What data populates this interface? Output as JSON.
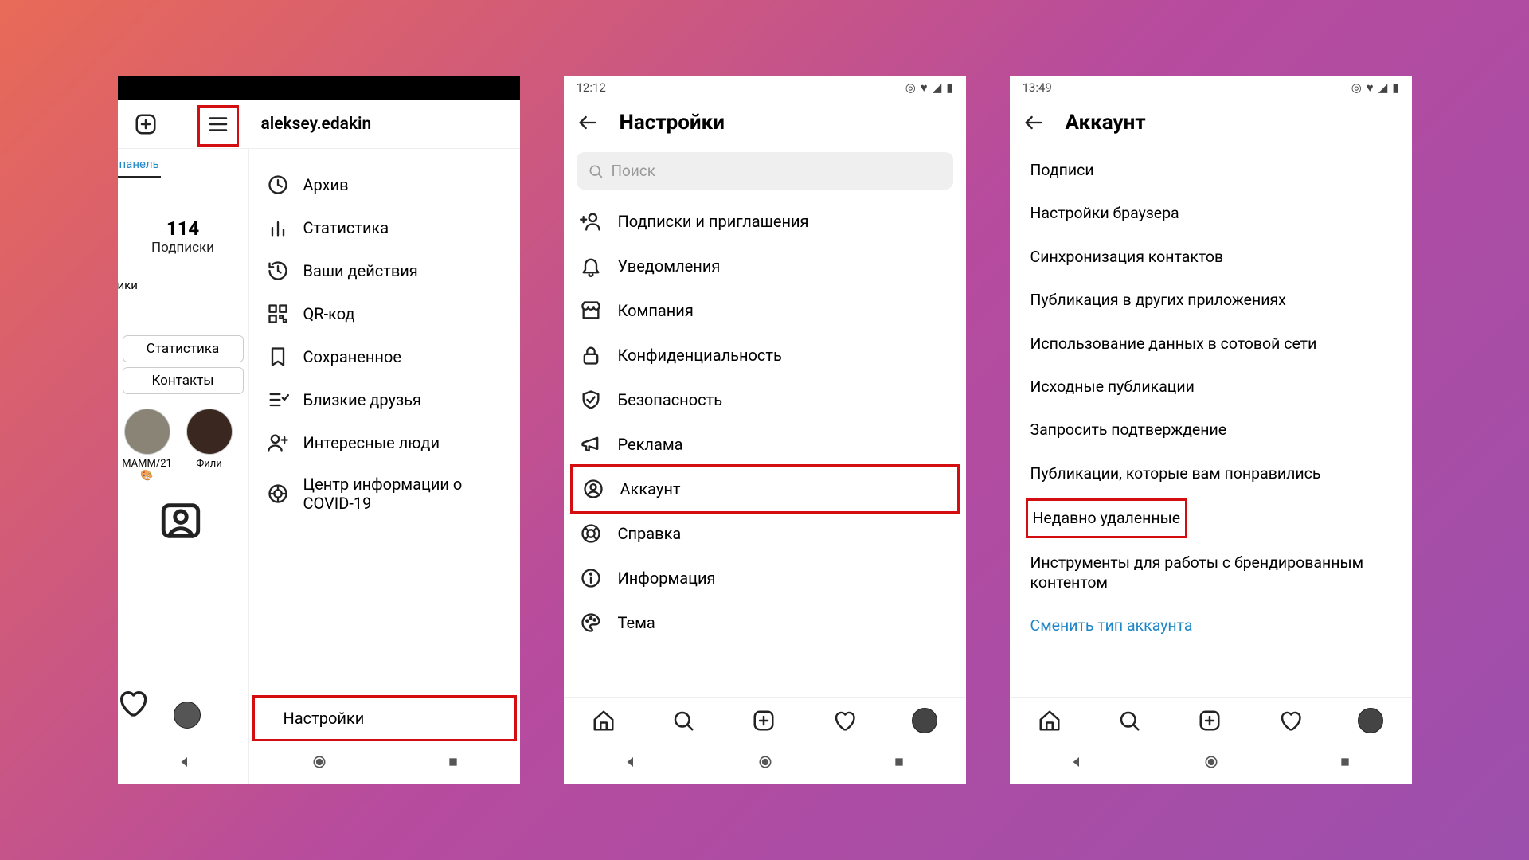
{
  "phone1": {
    "username": "aleksey.edakin",
    "panel_label": "панель",
    "stat_clip": "ики",
    "stats": {
      "num": "114",
      "label": "Подписки"
    },
    "chips": {
      "stats": "Статистика",
      "contacts": "Контакты"
    },
    "story1": "МАММ/21 🎨",
    "story2": "Фили",
    "menu": {
      "archive": "Архив",
      "insights": "Статистика",
      "activity": "Ваши действия",
      "qr": "QR-код",
      "saved": "Сохраненное",
      "close_friends": "Близкие друзья",
      "discover": "Интересные люди",
      "covid": "Центр информации о COVID-19",
      "settings": "Настройки"
    }
  },
  "phone2": {
    "time": "12:12",
    "title": "Настройки",
    "search_placeholder": "Поиск",
    "items": {
      "follow": "Подписки и приглашения",
      "notifications": "Уведомления",
      "company": "Компания",
      "privacy": "Конфиденциальность",
      "security": "Безопасность",
      "ads": "Реклама",
      "account": "Аккаунт",
      "help": "Справка",
      "about": "Информация",
      "theme": "Тема"
    }
  },
  "phone3": {
    "time": "13:49",
    "title": "Аккаунт",
    "items": {
      "captions": "Подписи",
      "browser": "Настройки браузера",
      "contacts_sync": "Синхронизация контактов",
      "share_other": "Публикация в других приложениях",
      "cell_data": "Использование данных в сотовой сети",
      "original": "Исходные публикации",
      "verify": "Запросить подтверждение",
      "liked": "Публикации, которые вам понравились",
      "recently_deleted": "Недавно удаленные",
      "branded": "Инструменты для работы с брендированным контентом",
      "switch": "Сменить тип аккаунта"
    }
  }
}
